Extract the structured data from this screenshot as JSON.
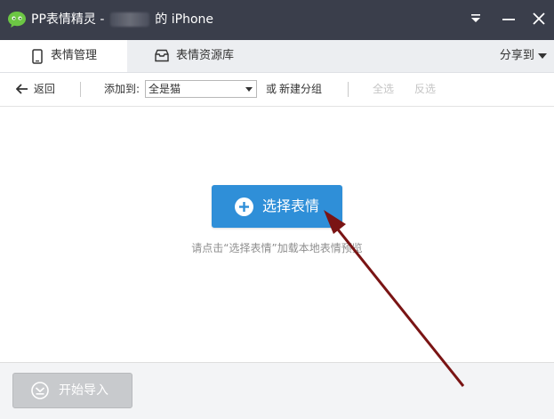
{
  "window": {
    "title_prefix": "PP表情精灵 -",
    "title_suffix": "的 iPhone",
    "logo_icon": "wechat-face-icon",
    "controls": [
      "menu-icon",
      "minimize-icon",
      "close-icon"
    ]
  },
  "tabs": [
    {
      "label": "表情管理",
      "icon": "phone-icon",
      "active": true
    },
    {
      "label": "表情资源库",
      "icon": "inbox-icon",
      "active": false
    }
  ],
  "share": {
    "label": "分享到"
  },
  "toolbar": {
    "back_label": "返回",
    "add_to_label": "添加到:",
    "group_select_value": "全是猫",
    "or_label": "或",
    "new_group_label": "新建分组",
    "select_all_label": "全选",
    "invert_label": "反选"
  },
  "main": {
    "choose_button_label": "选择表情",
    "hint_text": "请点击“选择表情”加载本地表情预览"
  },
  "footer": {
    "import_button_label": "开始导入"
  },
  "colors": {
    "titlebar": "#3a3e4b",
    "accent": "#2f8fd8",
    "arrow": "#7a1414",
    "disabled_button": "#c8cacd"
  }
}
